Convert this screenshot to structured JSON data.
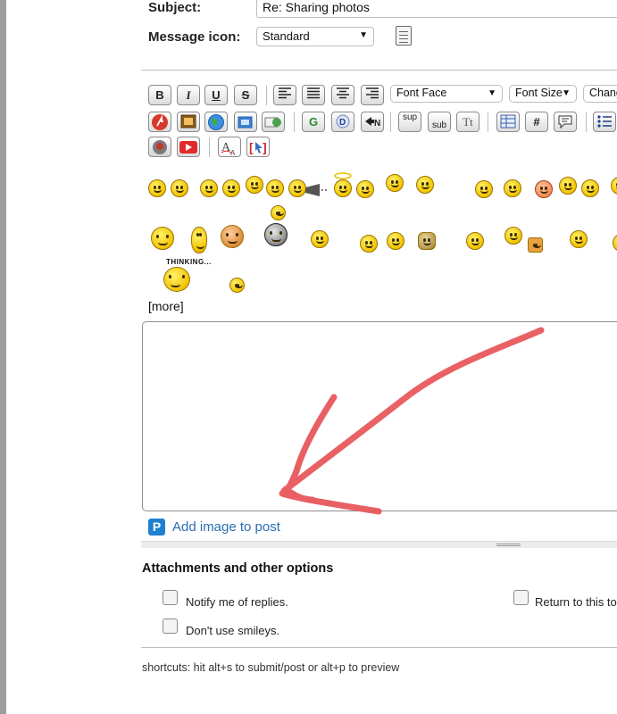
{
  "form": {
    "subject_label": "Subject:",
    "subject_value": "Re: Sharing photos",
    "message_icon_label": "Message icon:",
    "message_icon_value": "Standard"
  },
  "toolbar": {
    "bold": "B",
    "italic": "I",
    "underline": "U",
    "strike": "S",
    "font_face": "Font Face",
    "font_size": "Font Size",
    "change": "Chang",
    "google": "G",
    "sup": "sup",
    "sub": "sub",
    "tt": "Tt",
    "hash": "#"
  },
  "smilies": {
    "thinking_label": "THINKING...",
    "more_link": "[more]"
  },
  "editor": {
    "value": ""
  },
  "add_image": {
    "label": "Add image to post"
  },
  "attachments": {
    "title": "Attachments and other options",
    "notify_label": "Notify me of replies.",
    "return_label": "Return to this top",
    "no_smileys_label": "Don't use smileys."
  },
  "shortcuts": "shortcuts: hit alt+s to submit/post or alt+p to preview",
  "colors": {
    "annotation_arrow": "#e8585c",
    "link": "#2a6db3",
    "brand_icon": "#1f7fd1"
  }
}
